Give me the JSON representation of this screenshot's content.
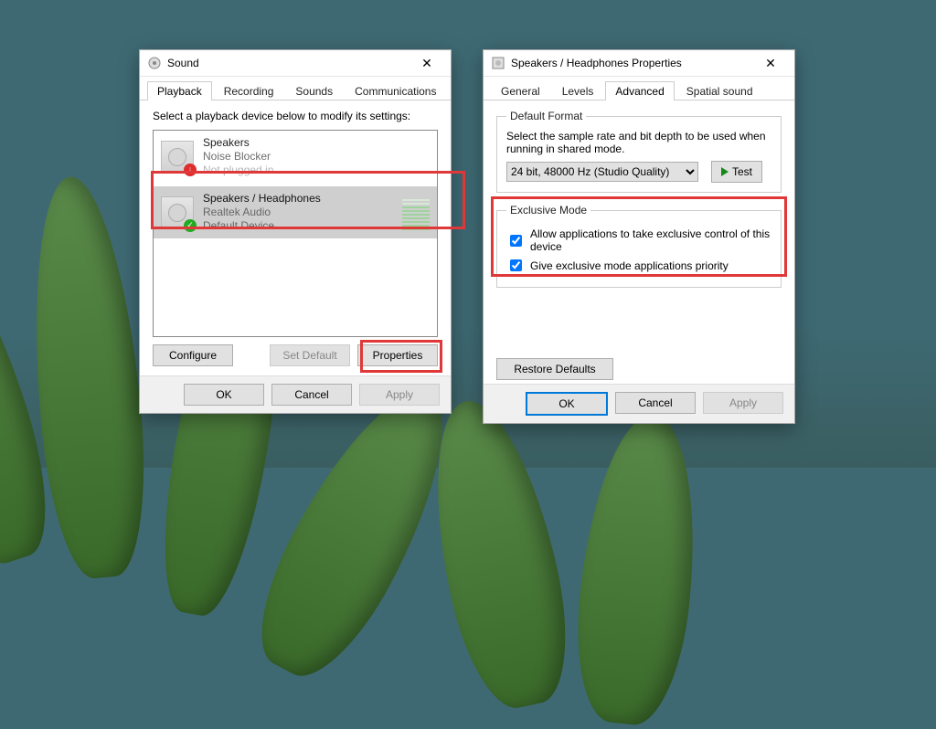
{
  "sound": {
    "title": "Sound",
    "tabs": [
      "Playback",
      "Recording",
      "Sounds",
      "Communications"
    ],
    "active_tab": 0,
    "instruction": "Select a playback device below to modify its settings:",
    "devices": [
      {
        "name": "Speakers",
        "line1": "Noise Blocker",
        "line2": "Not plugged in",
        "status": "unplugged",
        "selected": false
      },
      {
        "name": "Speakers / Headphones",
        "line1": "Realtek Audio",
        "line2": "Default Device",
        "status": "default",
        "selected": true
      }
    ],
    "buttons": {
      "configure": "Configure",
      "set_default": "Set Default",
      "properties": "Properties"
    },
    "footer": {
      "ok": "OK",
      "cancel": "Cancel",
      "apply": "Apply"
    }
  },
  "props": {
    "title": "Speakers / Headphones Properties",
    "tabs": [
      "General",
      "Levels",
      "Advanced",
      "Spatial sound"
    ],
    "active_tab": 2,
    "default_format": {
      "legend": "Default Format",
      "desc": "Select the sample rate and bit depth to be used when running in shared mode.",
      "value": "24 bit, 48000 Hz (Studio Quality)",
      "test": "Test"
    },
    "exclusive": {
      "legend": "Exclusive Mode",
      "opt1": "Allow applications to take exclusive control of this device",
      "opt2": "Give exclusive mode applications priority"
    },
    "restore": "Restore Defaults",
    "footer": {
      "ok": "OK",
      "cancel": "Cancel",
      "apply": "Apply"
    }
  }
}
